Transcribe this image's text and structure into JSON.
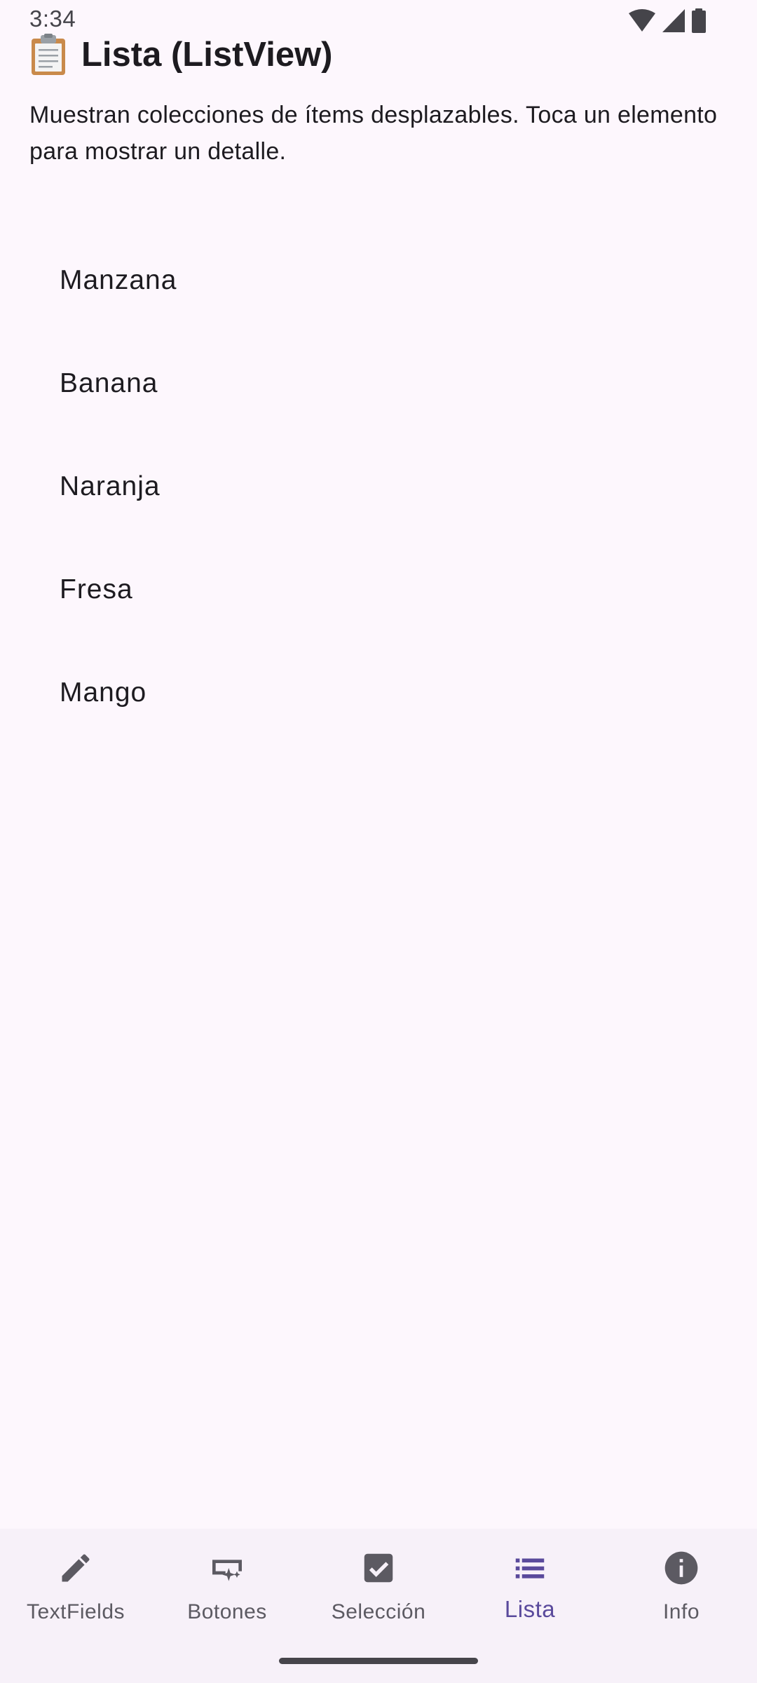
{
  "status_bar": {
    "time": "3:34",
    "icons": [
      "wifi-icon",
      "signal-icon",
      "battery-icon"
    ]
  },
  "header": {
    "icon": "clipboard-icon",
    "title": "Lista (ListView)"
  },
  "description": "Muestran colecciones de ítems desplazables. Toca un elemento para mostrar un detalle.",
  "list": {
    "items": [
      {
        "label": "Manzana"
      },
      {
        "label": "Banana"
      },
      {
        "label": "Naranja"
      },
      {
        "label": "Fresa"
      },
      {
        "label": "Mango"
      }
    ]
  },
  "bottom_nav": {
    "active_index": 3,
    "items": [
      {
        "label": "TextFields",
        "icon": "pencil-icon"
      },
      {
        "label": "Botones",
        "icon": "button-icon"
      },
      {
        "label": "Selección",
        "icon": "checkbox-icon"
      },
      {
        "label": "Lista",
        "icon": "list-icon"
      },
      {
        "label": "Info",
        "icon": "info-icon"
      }
    ]
  },
  "colors": {
    "background": "#fdf7fd",
    "nav_background": "#f7f1f9",
    "active_accent": "#5a4a9c",
    "inactive": "#5c5a62",
    "text": "#1d1b20"
  }
}
